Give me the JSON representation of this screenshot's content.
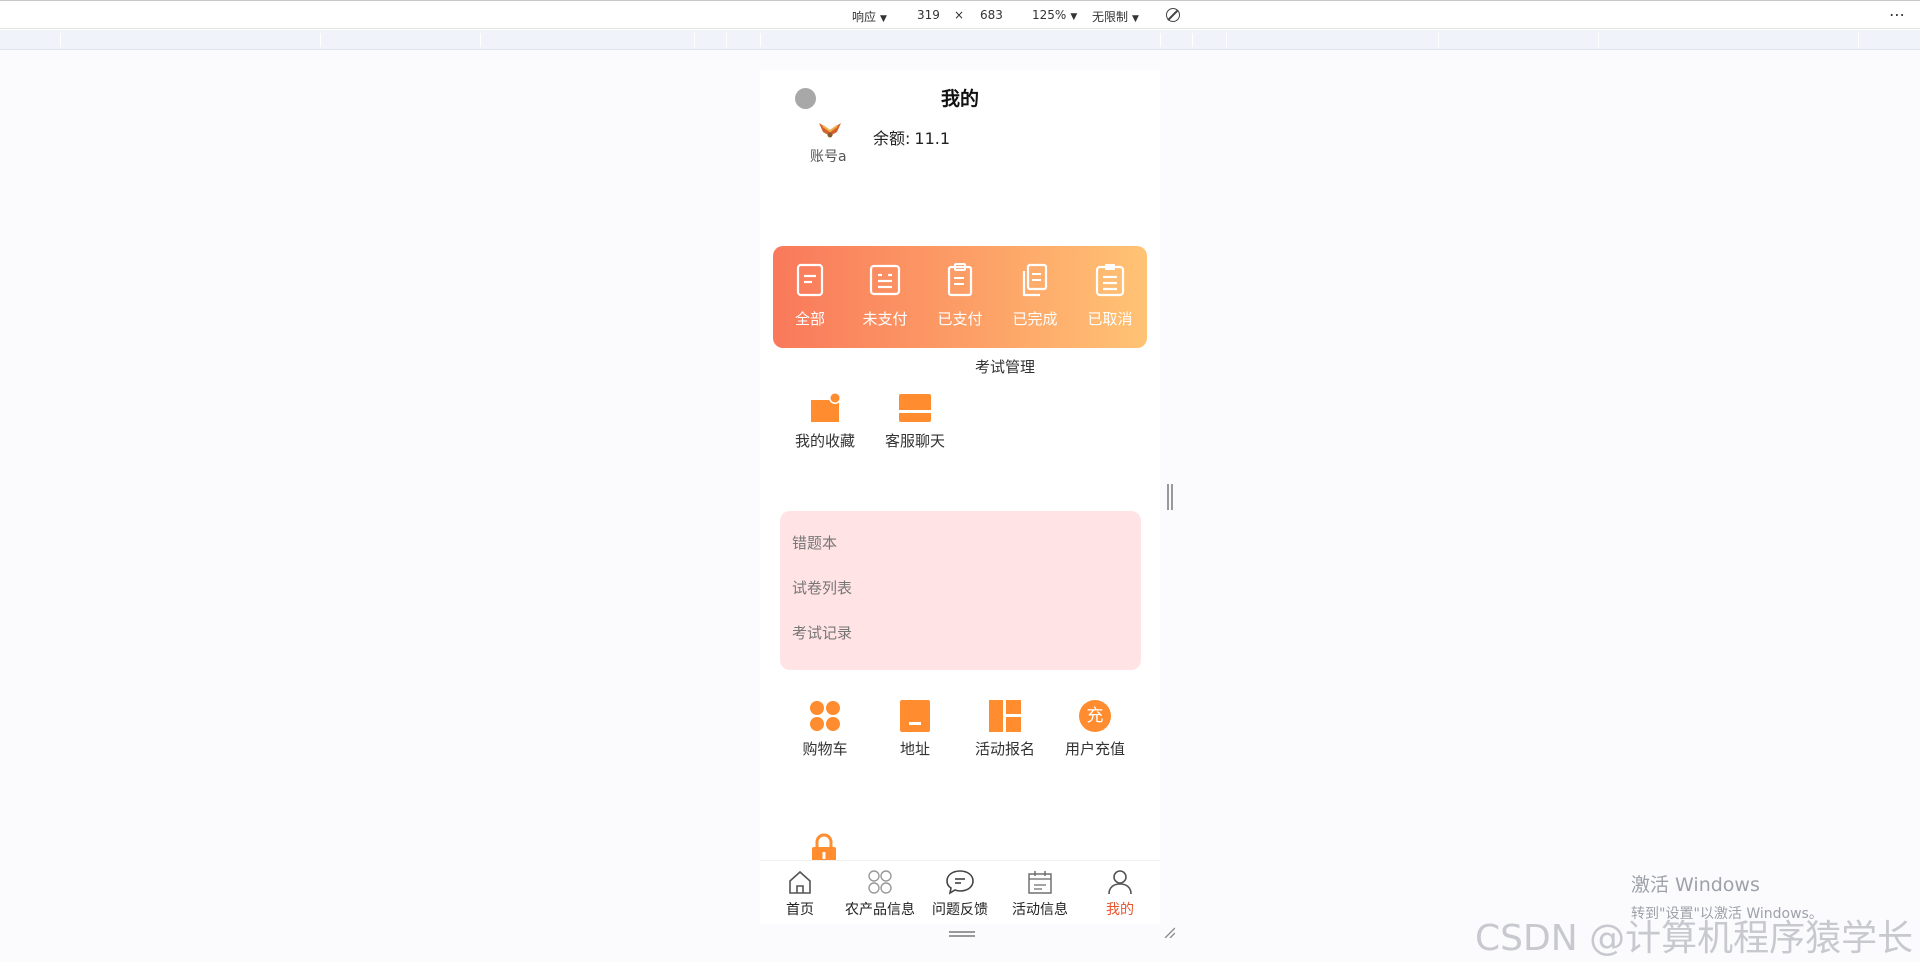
{
  "devtools": {
    "device": "响应",
    "width": "319",
    "times": "×",
    "height": "683",
    "zoom": "125%",
    "throttle": "无限制",
    "more": "⋯"
  },
  "page": {
    "title": "我的",
    "username": "账号a",
    "balance_label": "余额:",
    "balance_value": "11.1"
  },
  "orders": [
    {
      "label": "全部",
      "icon": "document-icon"
    },
    {
      "label": "未支付",
      "icon": "list-icon"
    },
    {
      "label": "已支付",
      "icon": "clipboard-icon"
    },
    {
      "label": "已完成",
      "icon": "copy-icon"
    },
    {
      "label": "已取消",
      "icon": "clipboard-list-icon"
    }
  ],
  "functions": [
    {
      "label": "我的收藏",
      "icon": "favorite-icon"
    },
    {
      "label": "客服聊天",
      "icon": "chat-icon"
    },
    {
      "label": "考试管理",
      "icon": ""
    }
  ],
  "exam_links": [
    "错题本",
    "试卷列表",
    "考试记录"
  ],
  "services": [
    {
      "label": "购物车",
      "icon": "grid-dots-icon"
    },
    {
      "label": "地址",
      "icon": "address-icon"
    },
    {
      "label": "活动报名",
      "icon": "layout-icon"
    },
    {
      "label": "用户充值",
      "icon": "recharge-icon",
      "glyph": "充"
    }
  ],
  "tabbar": [
    {
      "label": "首页",
      "icon": "home-icon",
      "active": false
    },
    {
      "label": "农产品信息",
      "icon": "apps-icon",
      "active": false
    },
    {
      "label": "问题反馈",
      "icon": "message-icon",
      "active": false
    },
    {
      "label": "活动信息",
      "icon": "calendar-icon",
      "active": false
    },
    {
      "label": "我的",
      "icon": "user-icon",
      "active": true
    }
  ],
  "watermarks": {
    "windows_title": "激活 Windows",
    "windows_sub": "转到\"设置\"以激活 Windows。",
    "csdn": "CSDN @计算机程序猿学长"
  },
  "colors": {
    "accent_orange": "#ff8c2e",
    "gradient_start": "#f9795b",
    "gradient_end": "#ffc374",
    "exam_bg": "#ffe3e5",
    "tab_active": "#e8542b"
  }
}
